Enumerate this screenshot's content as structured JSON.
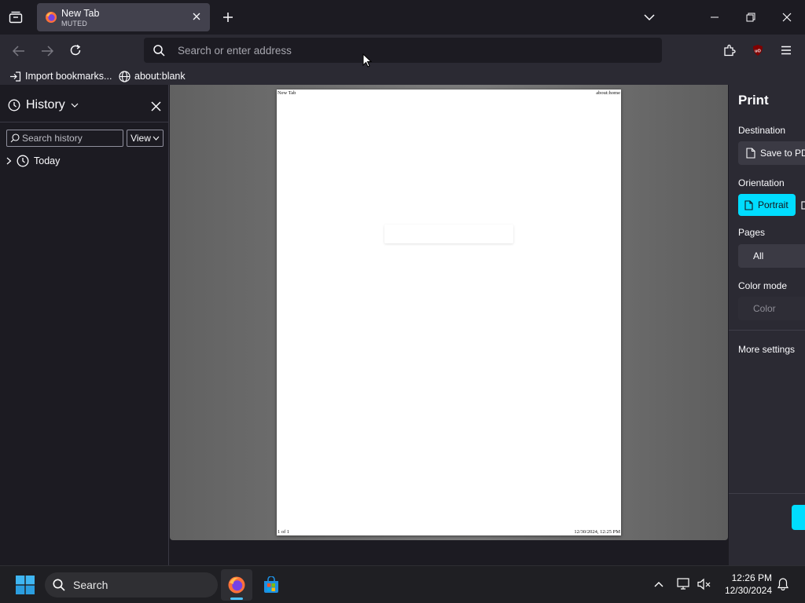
{
  "window": {
    "tab": {
      "title": "New Tab",
      "subtitle": "MUTED"
    }
  },
  "navbar": {
    "url_placeholder": "Search or enter address"
  },
  "bookmarks": {
    "items": [
      {
        "label": "Import bookmarks...",
        "icon": "import-icon"
      },
      {
        "label": "about:blank",
        "icon": "globe-icon"
      }
    ]
  },
  "sidebar": {
    "title": "History",
    "search_placeholder": "Search history",
    "view_label": "View",
    "groups": [
      {
        "label": "Today"
      }
    ]
  },
  "preview": {
    "header_left": "New Tab",
    "header_right": "about:home",
    "footer_left": "1 of 1",
    "footer_right": "12/30/2024, 12:25 PM"
  },
  "print": {
    "title": "Print",
    "destination_label": "Destination",
    "destination_value": "Save to PDF",
    "orientation_label": "Orientation",
    "orientation_value": "Portrait",
    "pages_label": "Pages",
    "pages_value": "All",
    "color_label": "Color mode",
    "color_value": "Color",
    "more_settings": "More settings"
  },
  "taskbar": {
    "search_label": "Search",
    "time": "12:26 PM",
    "date": "12/30/2024"
  },
  "colors": {
    "accent": "#00ddff",
    "chrome_dark": "#1c1b22",
    "toolbar": "#2b2a33"
  }
}
